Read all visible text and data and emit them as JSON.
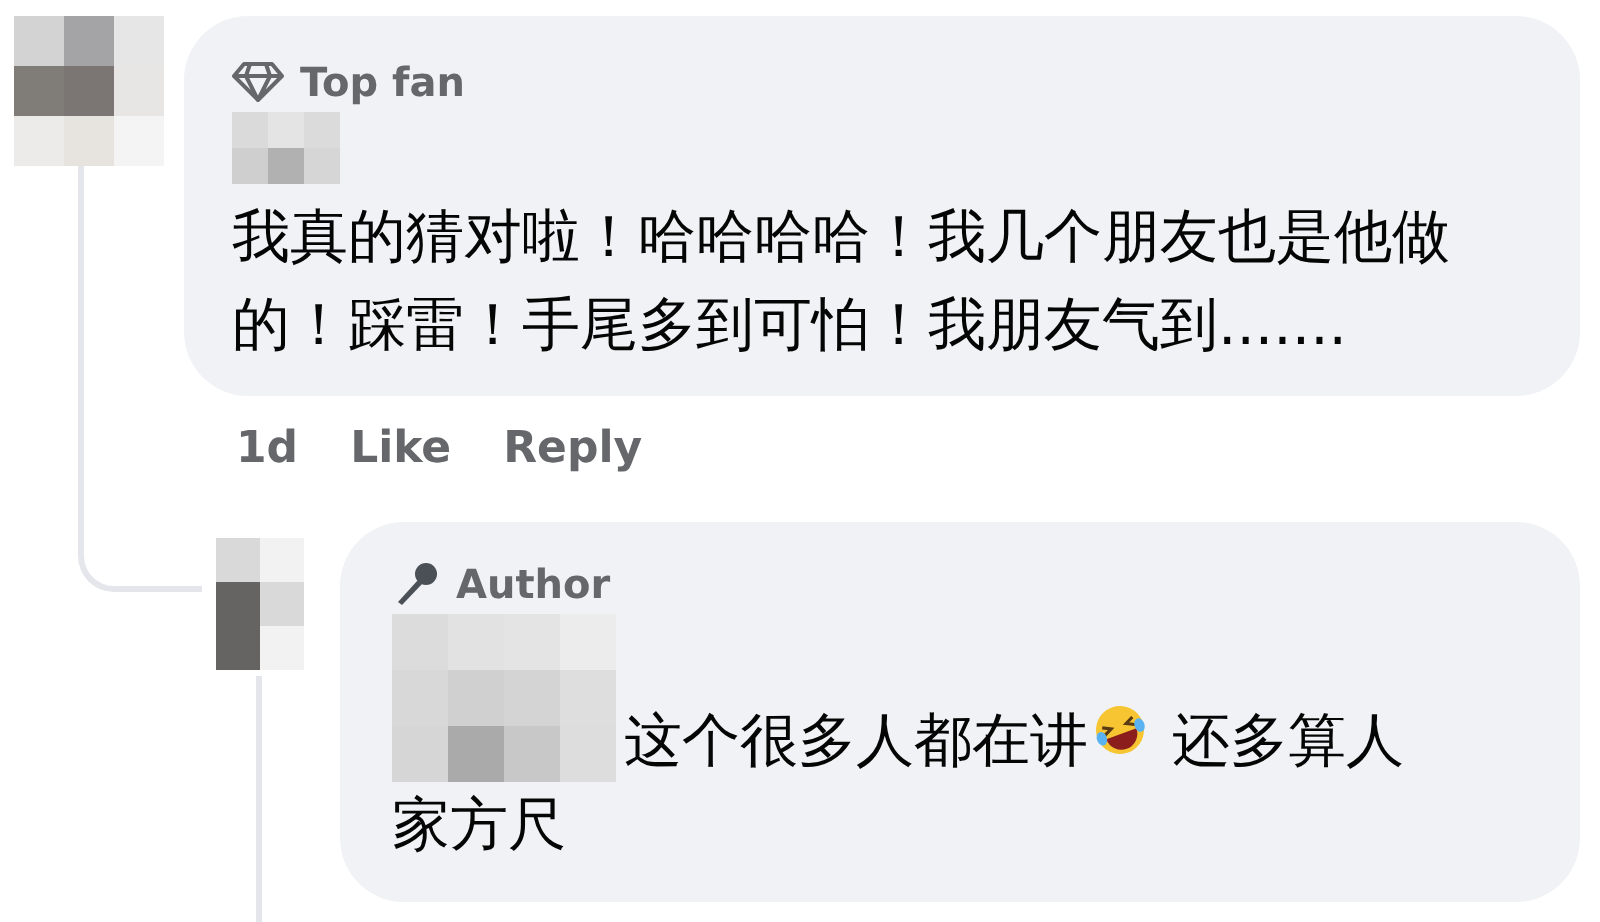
{
  "comment": {
    "badge": "Top fan",
    "text": "我真的猜对啦！哈哈哈哈！我几个朋友也是他做的！踩雷！手尾多到可怕！我朋友气到.......",
    "time": "1d",
    "actions": [
      "Like",
      "Reply"
    ]
  },
  "reply": {
    "badge": "Author",
    "text_before_emoji": "这个很多人都在讲",
    "text_after_emoji": "还多算人",
    "text_continued": "家方尺"
  }
}
